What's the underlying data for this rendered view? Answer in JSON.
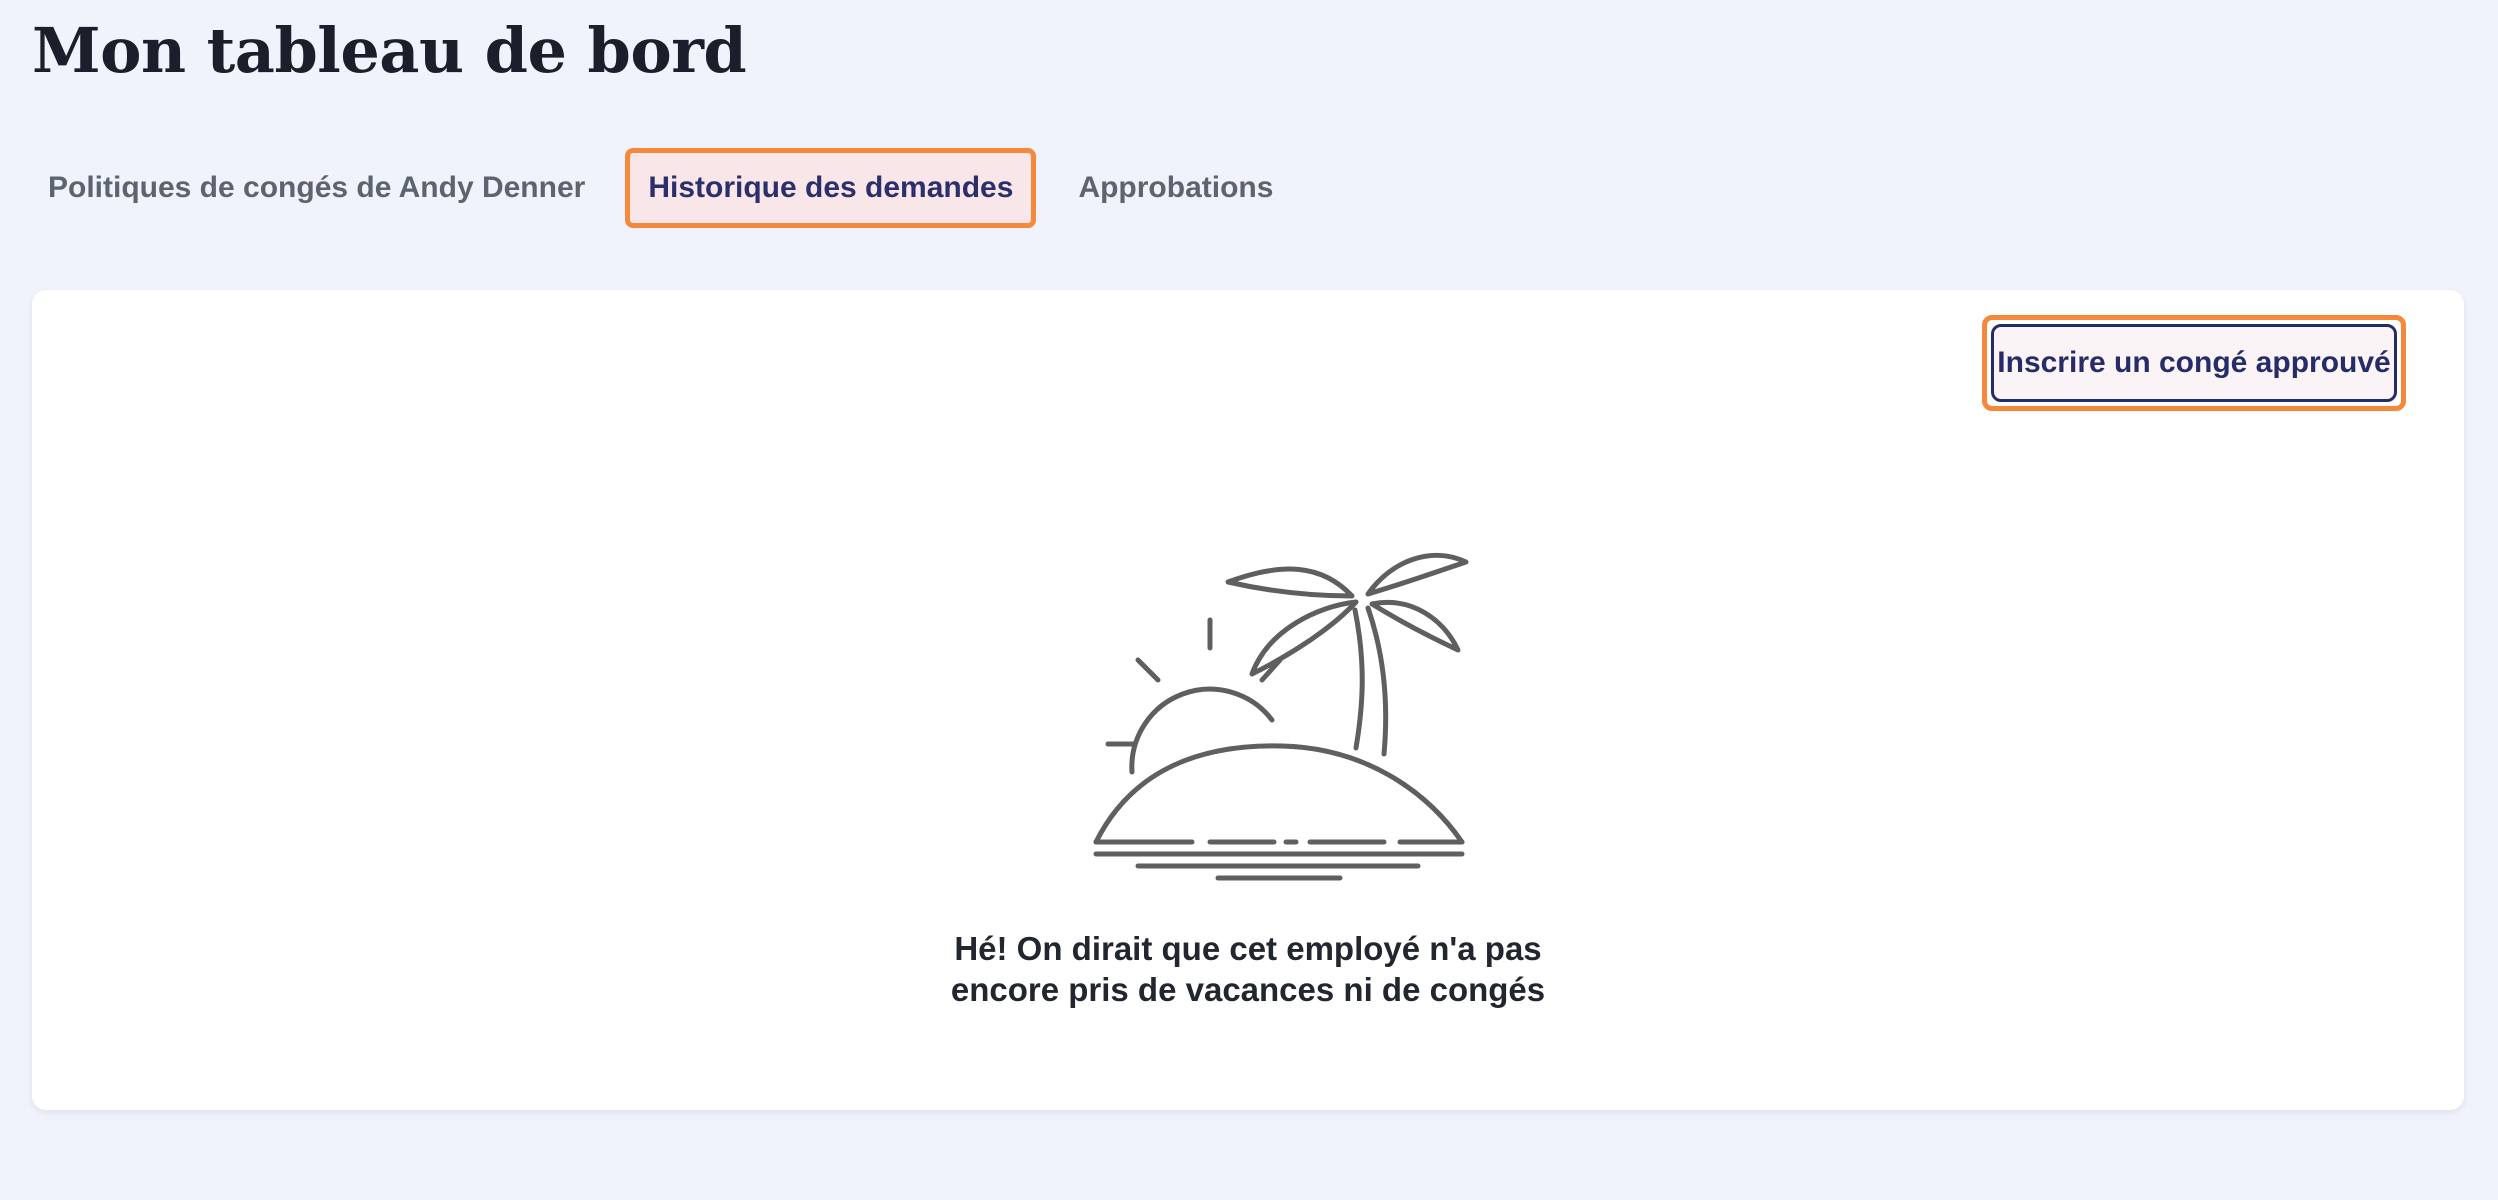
{
  "header": {
    "title": "Mon tableau de bord"
  },
  "tabs": [
    {
      "label": "Politiques de congés de Andy Denner",
      "active": false
    },
    {
      "label": "Historique des demandes",
      "active": true
    },
    {
      "label": "Approbations",
      "active": false
    }
  ],
  "card": {
    "action_label": "Inscrire un congé approuvé",
    "empty_state": {
      "icon": "palm-island-icon",
      "line1": "Hé! On dirait que cet employé n'a pas",
      "line2": "encore pris de vacances ni de congés"
    }
  },
  "colors": {
    "background": "#f0f3fb",
    "highlight": "#f5883a",
    "accent": "#262c68",
    "active_tab_bg": "#f8e6e8",
    "illustration_stroke": "#5f5f5f"
  }
}
